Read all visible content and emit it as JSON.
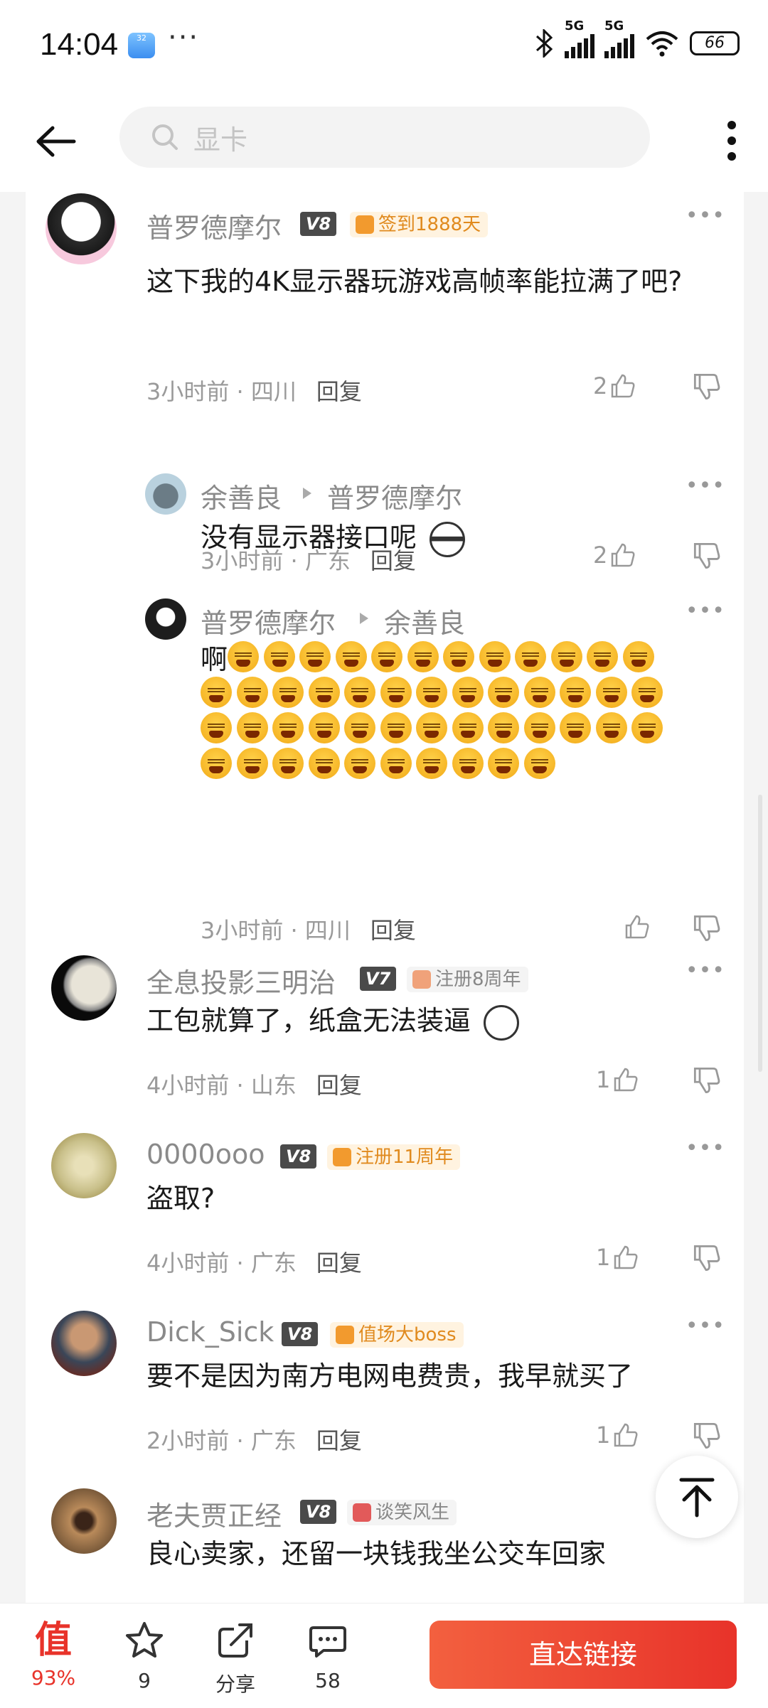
{
  "status_bar": {
    "time": "14:04",
    "weather_temp": "32",
    "dots": "···",
    "network1": "5G",
    "network2": "5G",
    "battery": "66"
  },
  "header": {
    "search_placeholder": "显卡"
  },
  "comments": [
    {
      "user": "普罗德摩尔",
      "level": "V8",
      "tag": "签到1888天",
      "text": "这下我的4K显示器玩游戏高帧率能拉满了吧?",
      "time": "3小时前",
      "loc": "四川",
      "reply": "回复",
      "likes": "2"
    },
    {
      "user": "余善良",
      "reply_to": "普罗德摩尔",
      "text": "没有显示器接口呢",
      "time": "3小时前",
      "loc": "广东",
      "reply": "回复",
      "likes": "2"
    },
    {
      "user": "普罗德摩尔",
      "reply_to": "余善良",
      "text": "啊",
      "emoji_count": 48,
      "time": "3小时前",
      "loc": "四川",
      "reply": "回复"
    },
    {
      "user": "全息投影三明治",
      "level": "V7",
      "tag": "注册8周年",
      "text": "工包就算了，纸盒无法装逼",
      "time": "4小时前",
      "loc": "山东",
      "reply": "回复",
      "likes": "1"
    },
    {
      "user": "0000ooo",
      "level": "V8",
      "tag": "注册11周年",
      "text": "盗取?",
      "time": "4小时前",
      "loc": "广东",
      "reply": "回复",
      "likes": "1"
    },
    {
      "user": "Dick_Sick",
      "level": "V8",
      "tag": "值场大boss",
      "text": "要不是因为南方电网电费贵，我早就买了",
      "time": "2小时前",
      "loc": "广东",
      "reply": "回复",
      "likes": "1"
    },
    {
      "user": "老夫贾正经",
      "level": "V8",
      "tag": "谈笑风生",
      "text": "良心卖家，还留一块钱我坐公交车回家"
    }
  ],
  "bottom_bar": {
    "worth_label": "值",
    "worth_pct": "93%",
    "fav_count": "9",
    "share_label": "分享",
    "comment_count": "58",
    "cta_label": "直达链接"
  },
  "colors": {
    "accent": "#e8332a",
    "tag_bg": "#fff3e0",
    "tag_fg": "#e08a1e"
  }
}
